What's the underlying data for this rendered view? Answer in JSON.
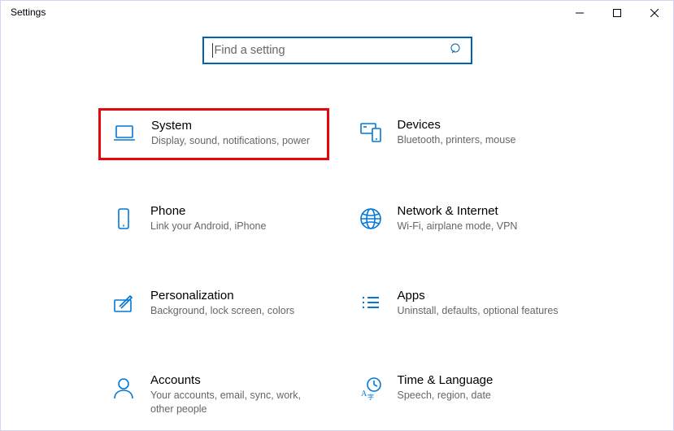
{
  "window": {
    "title": "Settings"
  },
  "search": {
    "placeholder": "Find a setting"
  },
  "tiles": {
    "system": {
      "title": "System",
      "desc": "Display, sound, notifications, power"
    },
    "devices": {
      "title": "Devices",
      "desc": "Bluetooth, printers, mouse"
    },
    "phone": {
      "title": "Phone",
      "desc": "Link your Android, iPhone"
    },
    "network": {
      "title": "Network & Internet",
      "desc": "Wi-Fi, airplane mode, VPN"
    },
    "personalization": {
      "title": "Personalization",
      "desc": "Background, lock screen, colors"
    },
    "apps": {
      "title": "Apps",
      "desc": "Uninstall, defaults, optional features"
    },
    "accounts": {
      "title": "Accounts",
      "desc": "Your accounts, email, sync, work, other people"
    },
    "time": {
      "title": "Time & Language",
      "desc": "Speech, region, date"
    }
  }
}
